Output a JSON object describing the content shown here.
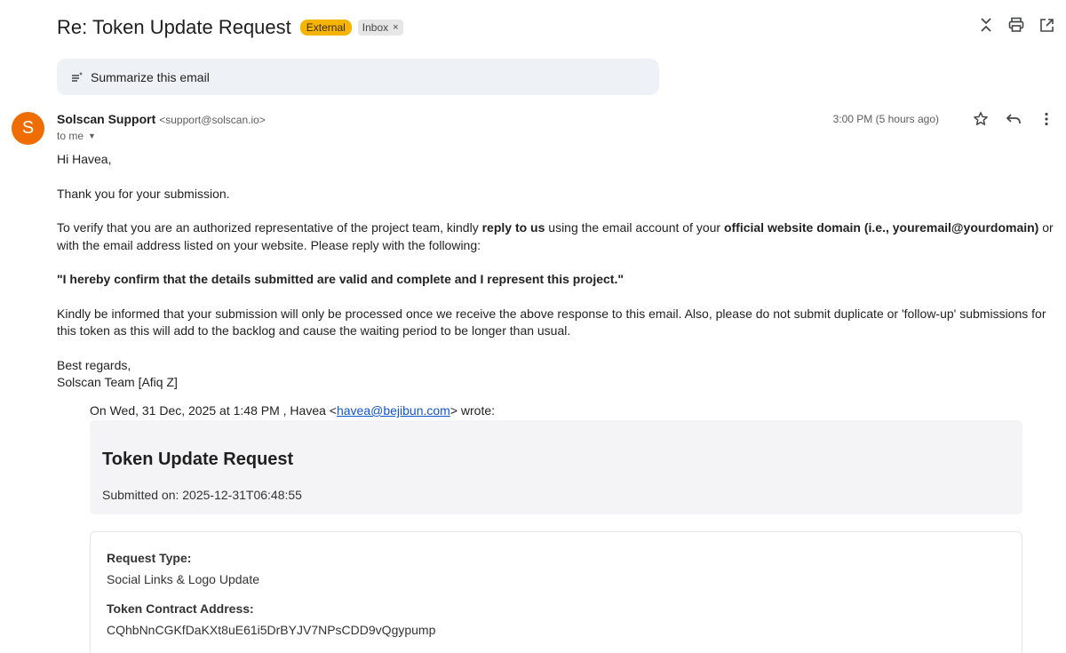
{
  "email": {
    "subject": "Re: Token Update Request",
    "labels": {
      "external": "External",
      "inbox": "Inbox",
      "remove": "×"
    },
    "summarize": "Summarize this email",
    "sender": {
      "initial": "S",
      "name": "Solscan Support",
      "address": "<support@solscan.io>",
      "to": "to me",
      "time": "3:00 PM (5 hours ago)"
    },
    "body": {
      "greeting": "Hi Havea,",
      "thanks": "Thank you for your submission.",
      "verify_1": "To verify that you are an authorized representative of the project team, kindly ",
      "verify_bold_1": "reply to us",
      "verify_2": " using the email account of your ",
      "verify_bold_2": "official website domain (i.e., youremail@yourdomain)",
      "verify_3": " or with the email address listed on your website. Please reply with the following:",
      "confirm": "\"I hereby confirm that the details submitted are valid and complete and I represent this project.\"",
      "notice": "Kindly be informed that your submission will only be processed once we receive the above response to this email. Also, please do not submit duplicate or 'follow-up' submissions for this token as this will add to the backlog and cause the waiting period to be longer than usual.",
      "closing": "Best regards,",
      "signature": "Solscan Team [Afiq Z]"
    },
    "quote": {
      "prefix": "On Wed, 31 Dec, 2025 at 1:48 PM , Havea <",
      "link": "havea@bejibun.com",
      "suffix": "> wrote:",
      "title": "Token Update Request",
      "submitted": "Submitted on: 2025-12-31T06:48:55",
      "request_type_label": "Request Type:",
      "request_type_value": "Social Links & Logo Update",
      "contract_label": "Token Contract Address:",
      "contract_value": "CQhbNnCGKfDaKXt8uE61i5DrBYJV7NPsCDD9vQgypump"
    }
  },
  "colors": {
    "avatar": "#ef6c00",
    "external_badge": "#f5b400",
    "summarize_bg": "#eef1f6"
  }
}
